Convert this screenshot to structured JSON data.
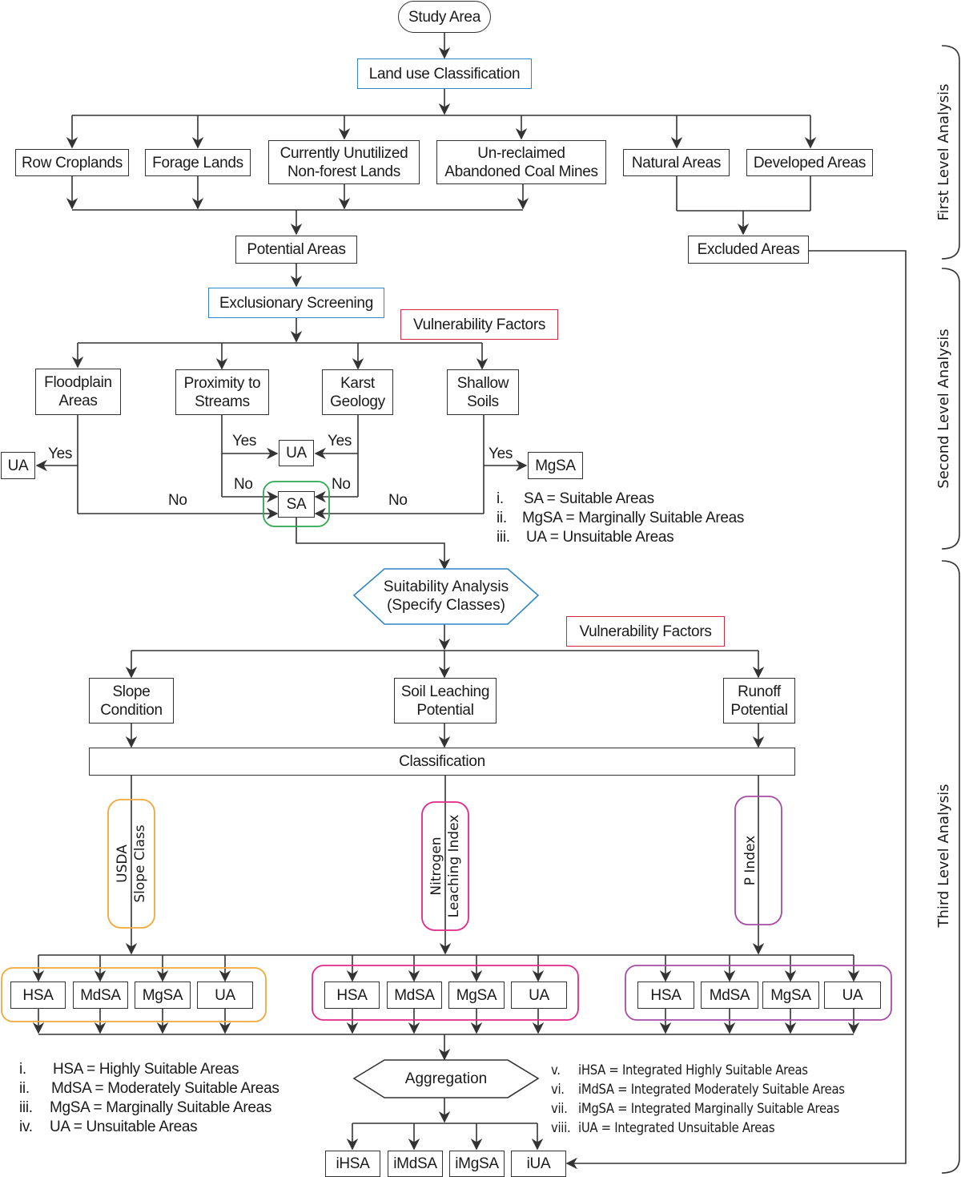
{
  "title": "Study Area",
  "first_level": {
    "land_use": "Land use Classification",
    "categories": [
      {
        "label": "Row Croplands"
      },
      {
        "label": "Forage Lands"
      },
      {
        "label": "Currently Unutilized",
        "label2": "Non-forest Lands"
      },
      {
        "label": "Un-reclaimed",
        "label2": "Abandoned Coal Mines"
      },
      {
        "label": "Natural Areas"
      },
      {
        "label": "Developed Areas"
      }
    ],
    "potential": "Potential Areas",
    "excluded": "Excluded Areas"
  },
  "second_level": {
    "screening": "Exclusionary Screening",
    "vulnerability": "Vulnerability Factors",
    "factors": [
      {
        "l1": "Floodplain",
        "l2": "Areas"
      },
      {
        "l1": "Proximity to",
        "l2": "Streams"
      },
      {
        "l1": "Karst",
        "l2": "Geology"
      },
      {
        "l1": "Shallow",
        "l2": "Soils"
      }
    ],
    "ua_left": "UA",
    "ua_center": "UA",
    "mgsa": "MgSA",
    "sa": "SA",
    "yes": "Yes",
    "no": "No",
    "legend": [
      {
        "num": "i.",
        "text": "SA = Suitable Areas"
      },
      {
        "num": "ii.",
        "text": "MgSA = Marginally Suitable Areas"
      },
      {
        "num": "iii.",
        "text": "UA = Unsuitable Areas"
      }
    ]
  },
  "third_level": {
    "suitability_l1": "Suitability Analysis",
    "suitability_l2": "(Specify Classes)",
    "vulnerability": "Vulnerability Factors",
    "factors": [
      {
        "l1": "Slope",
        "l2": "Condition"
      },
      {
        "l1": "Soil Leaching",
        "l2": "Potential"
      },
      {
        "l1": "Runoff",
        "l2": "Potential"
      }
    ],
    "classification": "Classification",
    "indices": [
      {
        "l1": "USDA",
        "l2": "Slope Class",
        "color": "#f2a93b"
      },
      {
        "l1": "Nitrogen",
        "l2": "Leaching Index",
        "color": "#e3288a"
      },
      {
        "l1": "P Index",
        "l2": "",
        "color": "#a64ca6"
      }
    ],
    "classes": [
      "HSA",
      "MdSA",
      "MgSA",
      "UA"
    ],
    "aggregation": "Aggregation",
    "outputs": [
      "iHSA",
      "iMdSA",
      "iMgSA",
      "iUA"
    ],
    "legend_left": [
      {
        "num": "i.",
        "text": "HSA = Highly Suitable Areas"
      },
      {
        "num": "ii.",
        "text": "MdSA = Moderately Suitable Areas"
      },
      {
        "num": "iii.",
        "text": "MgSA = Marginally Suitable Areas"
      },
      {
        "num": "iv.",
        "text": "UA = Unsuitable Areas"
      }
    ],
    "legend_right": [
      {
        "num": "v.",
        "text": "iHSA = Integrated Highly Suitable Areas"
      },
      {
        "num": "vi.",
        "text": "iMdSA = Integrated Moderately Suitable Areas"
      },
      {
        "num": "vii.",
        "text": "iMgSA = Integrated Marginally Suitable Areas"
      },
      {
        "num": "viii.",
        "text": "iUA = Integrated Unsuitable Areas"
      }
    ]
  },
  "side_labels": [
    "First Level Analysis",
    "Second Level Analysis",
    "Third Level Analysis"
  ],
  "colors": {
    "line": "#333333",
    "blue": "#2f86c8",
    "red": "#d1293d",
    "green": "#2ea84f",
    "orange": "#f2a93b",
    "pink": "#e3288a",
    "purple": "#a64ca6"
  }
}
